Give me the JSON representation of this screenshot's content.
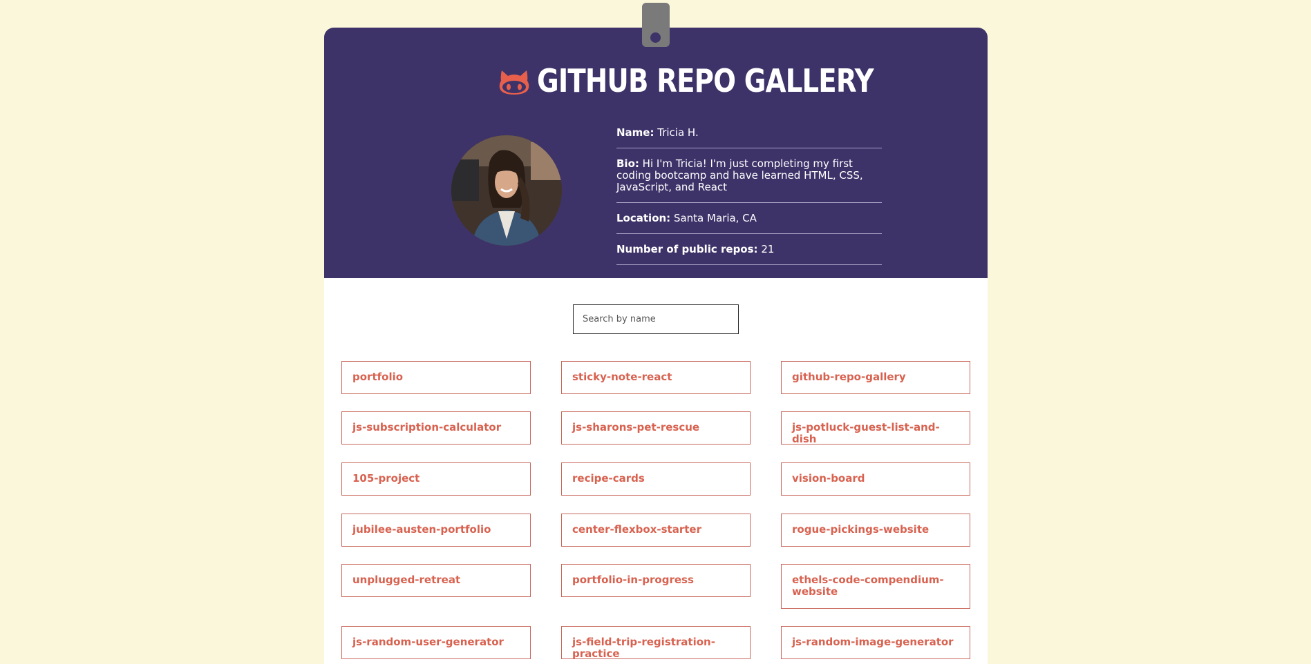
{
  "header": {
    "title": "GITHUB REPO GALLERY",
    "logo_icon": "octocat-icon",
    "accent_color": "#3e3369",
    "logo_color": "#e8604c"
  },
  "profile": {
    "avatar_alt": "Tricia H. avatar",
    "name_label": "Name:",
    "name_value": "Tricia H.",
    "bio_label": "Bio:",
    "bio_value": "Hi I'm Tricia! I'm just completing my first coding bootcamp and have learned HTML, CSS, JavaScript, and React",
    "location_label": "Location:",
    "location_value": "Santa Maria, CA",
    "repos_label": "Number of public repos:",
    "repos_value": "21"
  },
  "search": {
    "placeholder": "Search by name",
    "value": ""
  },
  "repos": [
    "portfolio",
    "sticky-note-react",
    "github-repo-gallery",
    "js-subscription-calculator",
    "js-sharons-pet-rescue",
    "js-potluck-guest-list-and-dish",
    "105-project",
    "recipe-cards",
    "vision-board",
    "jubilee-austen-portfolio",
    "center-flexbox-starter",
    "rogue-pickings-website",
    "unplugged-retreat",
    "portfolio-in-progress",
    "ethels-code-compendium-website",
    "js-random-user-generator",
    "js-field-trip-registration-practice",
    "js-random-image-generator"
  ],
  "colors": {
    "page_background": "#fbf7da",
    "repo_text": "#d86250",
    "repo_border": "#c8675a"
  }
}
